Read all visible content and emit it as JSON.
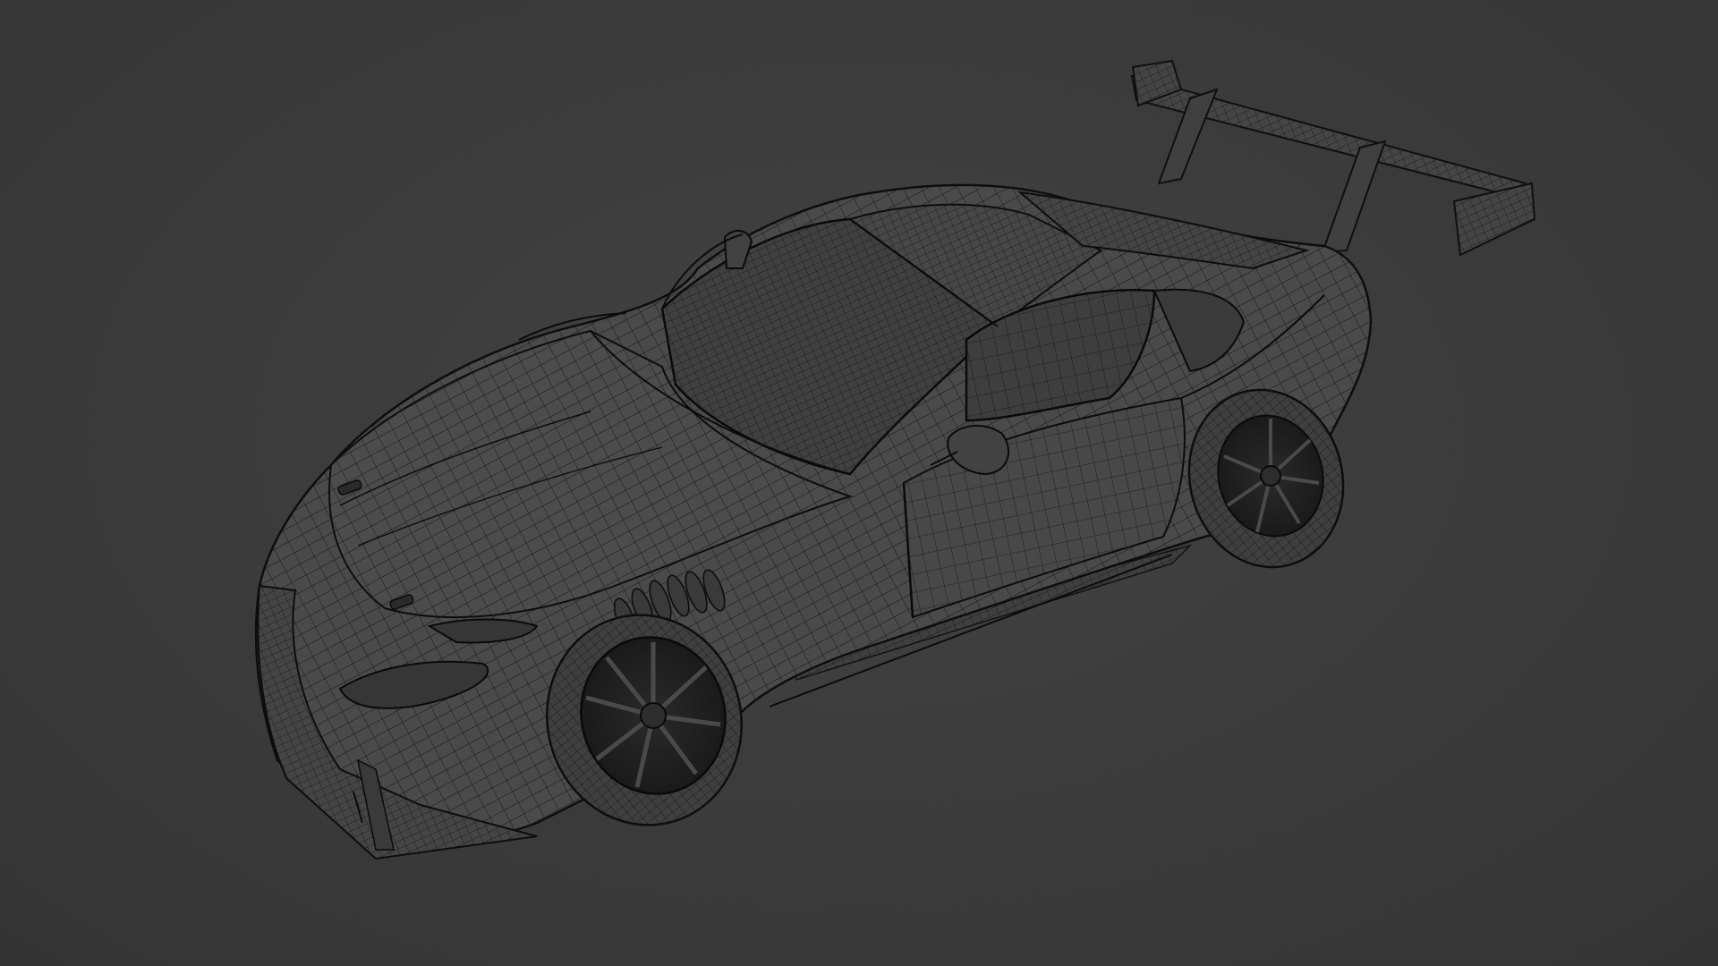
{
  "viewport": {
    "background_color": "#3b3b3b",
    "wire_color": "#101010",
    "body_color": "#4a4a4a",
    "shading": "wireframe-overlay"
  },
  "subject": {
    "object": "race-car-model",
    "view": "three-quarter-top-front"
  }
}
